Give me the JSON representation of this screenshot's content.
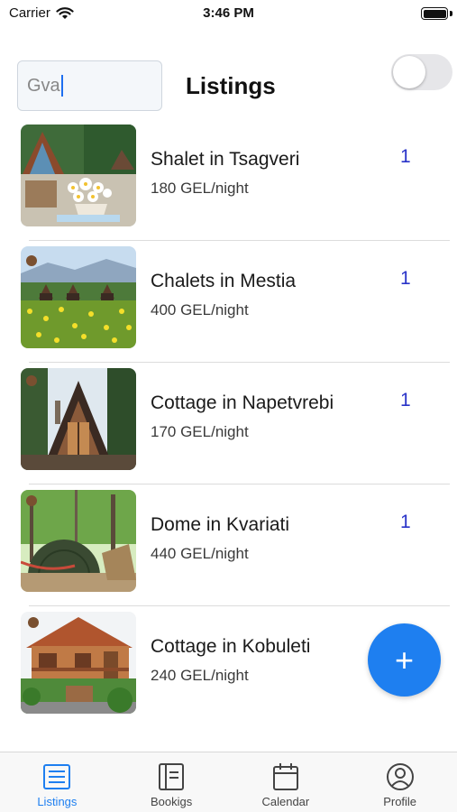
{
  "status_bar": {
    "carrier": "Carrier",
    "time": "3:46 PM",
    "icons": [
      "wifi-icon",
      "battery-icon"
    ]
  },
  "header": {
    "search_value": "Gva",
    "title": "Listings",
    "toggle_on": false
  },
  "listings": [
    {
      "title": "Shalet in Tsagveri",
      "price": "180 GEL/night",
      "count": "1",
      "image": "chalet-flowers-photo"
    },
    {
      "title": "Chalets in Mestia",
      "price": "400 GEL/night",
      "count": "1",
      "image": "meadow-chalets-photo"
    },
    {
      "title": "Cottage in Napetvrebi",
      "price": "170 GEL/night",
      "count": "1",
      "image": "a-frame-cottage-photo"
    },
    {
      "title": "Dome in Kvariati",
      "price": "440 GEL/night",
      "count": "1",
      "image": "forest-dome-photo"
    },
    {
      "title": "Cottage in Kobuleti",
      "price": "240 GEL/night",
      "count": "",
      "image": "wooden-cottage-photo"
    }
  ],
  "fab": {
    "label": "+"
  },
  "tabs": [
    {
      "label": "Listings",
      "icon": "list-icon",
      "active": true
    },
    {
      "label": "Bookigs",
      "icon": "notebook-icon",
      "active": false
    },
    {
      "label": "Calendar",
      "icon": "calendar-icon",
      "active": false
    },
    {
      "label": "Profile",
      "icon": "user-circle-icon",
      "active": false
    }
  ],
  "colors": {
    "accent": "#1e7ff0",
    "count": "#2933c8",
    "inactive_tab": "#444444"
  }
}
